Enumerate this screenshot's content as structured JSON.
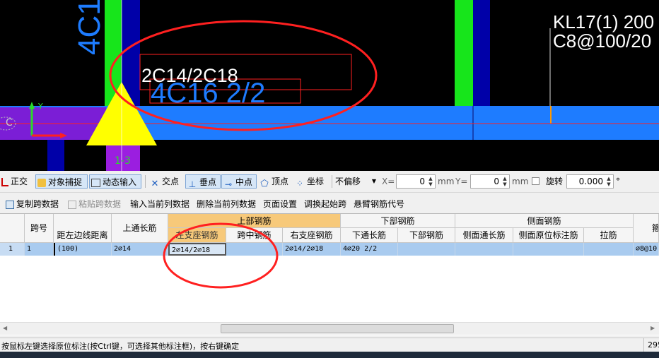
{
  "cad": {
    "label_4c1": "4C1",
    "label_2c14": "2C14/2C18",
    "label_4c16": "4C16 2/2",
    "label_kl17": "KL17(1) 200",
    "label_c8": "C8@100/20",
    "label_1_3": "1-3",
    "label_c": "C",
    "axis_y": "Y",
    "annotation_color": "#ff2020",
    "beam_color": "#1e7cff",
    "column_color": "#17e51b"
  },
  "toolbar": {
    "ortho": "正交",
    "object_snap": "对象捕捉",
    "dynamic_input": "动态输入",
    "intersection": "交点",
    "perpendicular": "垂点",
    "midpoint": "中点",
    "vertex": "顶点",
    "coordinate": "坐标",
    "offset_select": "不偏移",
    "x_label": "X=",
    "x_value": "0",
    "x_unit": "mm",
    "y_label": "Y=",
    "y_value": "0",
    "y_unit": "mm",
    "rotate": "旋转",
    "rotate_value": "0.000",
    "degree": "°"
  },
  "gridbar": {
    "copy": "复制跨数据",
    "paste": "粘贴跨数据",
    "input_column": "输入当前列数据",
    "delete_column": "删除当前列数据",
    "page_setup": "页面设置",
    "adjust_start": "调换起始跨",
    "cantilever": "悬臂钢筋代号"
  },
  "grid": {
    "headers": {
      "span": "跨号",
      "dist_left": "距左边线距离",
      "top_long": "上通长筋",
      "top_group": "上部钢筋",
      "left_support": "左支座钢筋",
      "mid_span": "跨中钢筋",
      "right_support": "右支座钢筋",
      "bottom_group": "下部钢筋",
      "bottom_long": "下通长筋",
      "bottom_rebar": "下部钢筋",
      "side_group": "侧面钢筋",
      "side_long": "侧面通长筋",
      "side_in_situ": "侧面原位标注筋",
      "tie": "拉筋",
      "stirrup": "箍"
    },
    "row": {
      "index": "1",
      "span": "1",
      "dist_left": "(100)",
      "top_long": "2⌀14",
      "left_support": "2⌀14/2⌀18",
      "mid_span": "",
      "right_support": "2⌀14/2⌀18",
      "bottom_long": "4⌀20 2/2",
      "stirrup": "⌀8@10"
    }
  },
  "status": {
    "message": "按鼠标左键选择原位标注(按Ctrl键，可选择其他标注框)，按右键确定",
    "right_value": "295"
  }
}
